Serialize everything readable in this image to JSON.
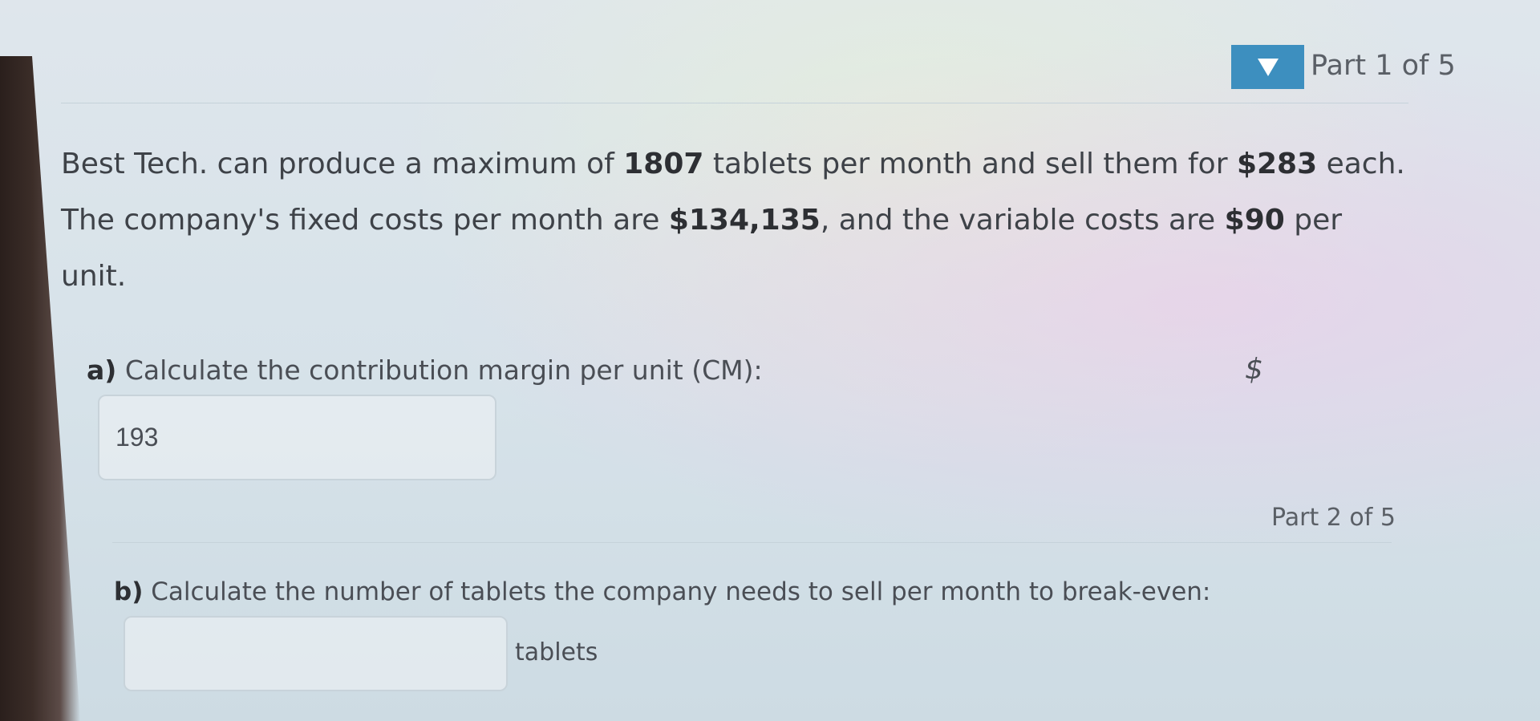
{
  "header": {
    "part_label": "Part 1 of 5",
    "toggle_icon": "caret-down-icon",
    "toggle_color": "#3d8fbf"
  },
  "problem": {
    "t1": "Best Tech. can produce a maximum of ",
    "max_tablets": "1807",
    "t2": " tablets per month and sell them for ",
    "price": "$283",
    "t3": " each. The company's fixed costs per month are ",
    "fixed_costs": "$134,135",
    "t4": ", and the variable costs are ",
    "variable_cost": "$90",
    "t5": " per unit."
  },
  "part_a": {
    "letter": "a)",
    "prompt": " Calculate the contribution margin per unit (CM):",
    "unit_prefix": "$",
    "answer": "193"
  },
  "part_b": {
    "part_label": "Part 2 of 5",
    "letter": "b)",
    "prompt": " Calculate the number of tablets the company needs to sell per month to break-even:",
    "answer": "",
    "unit_suffix": "tablets"
  }
}
